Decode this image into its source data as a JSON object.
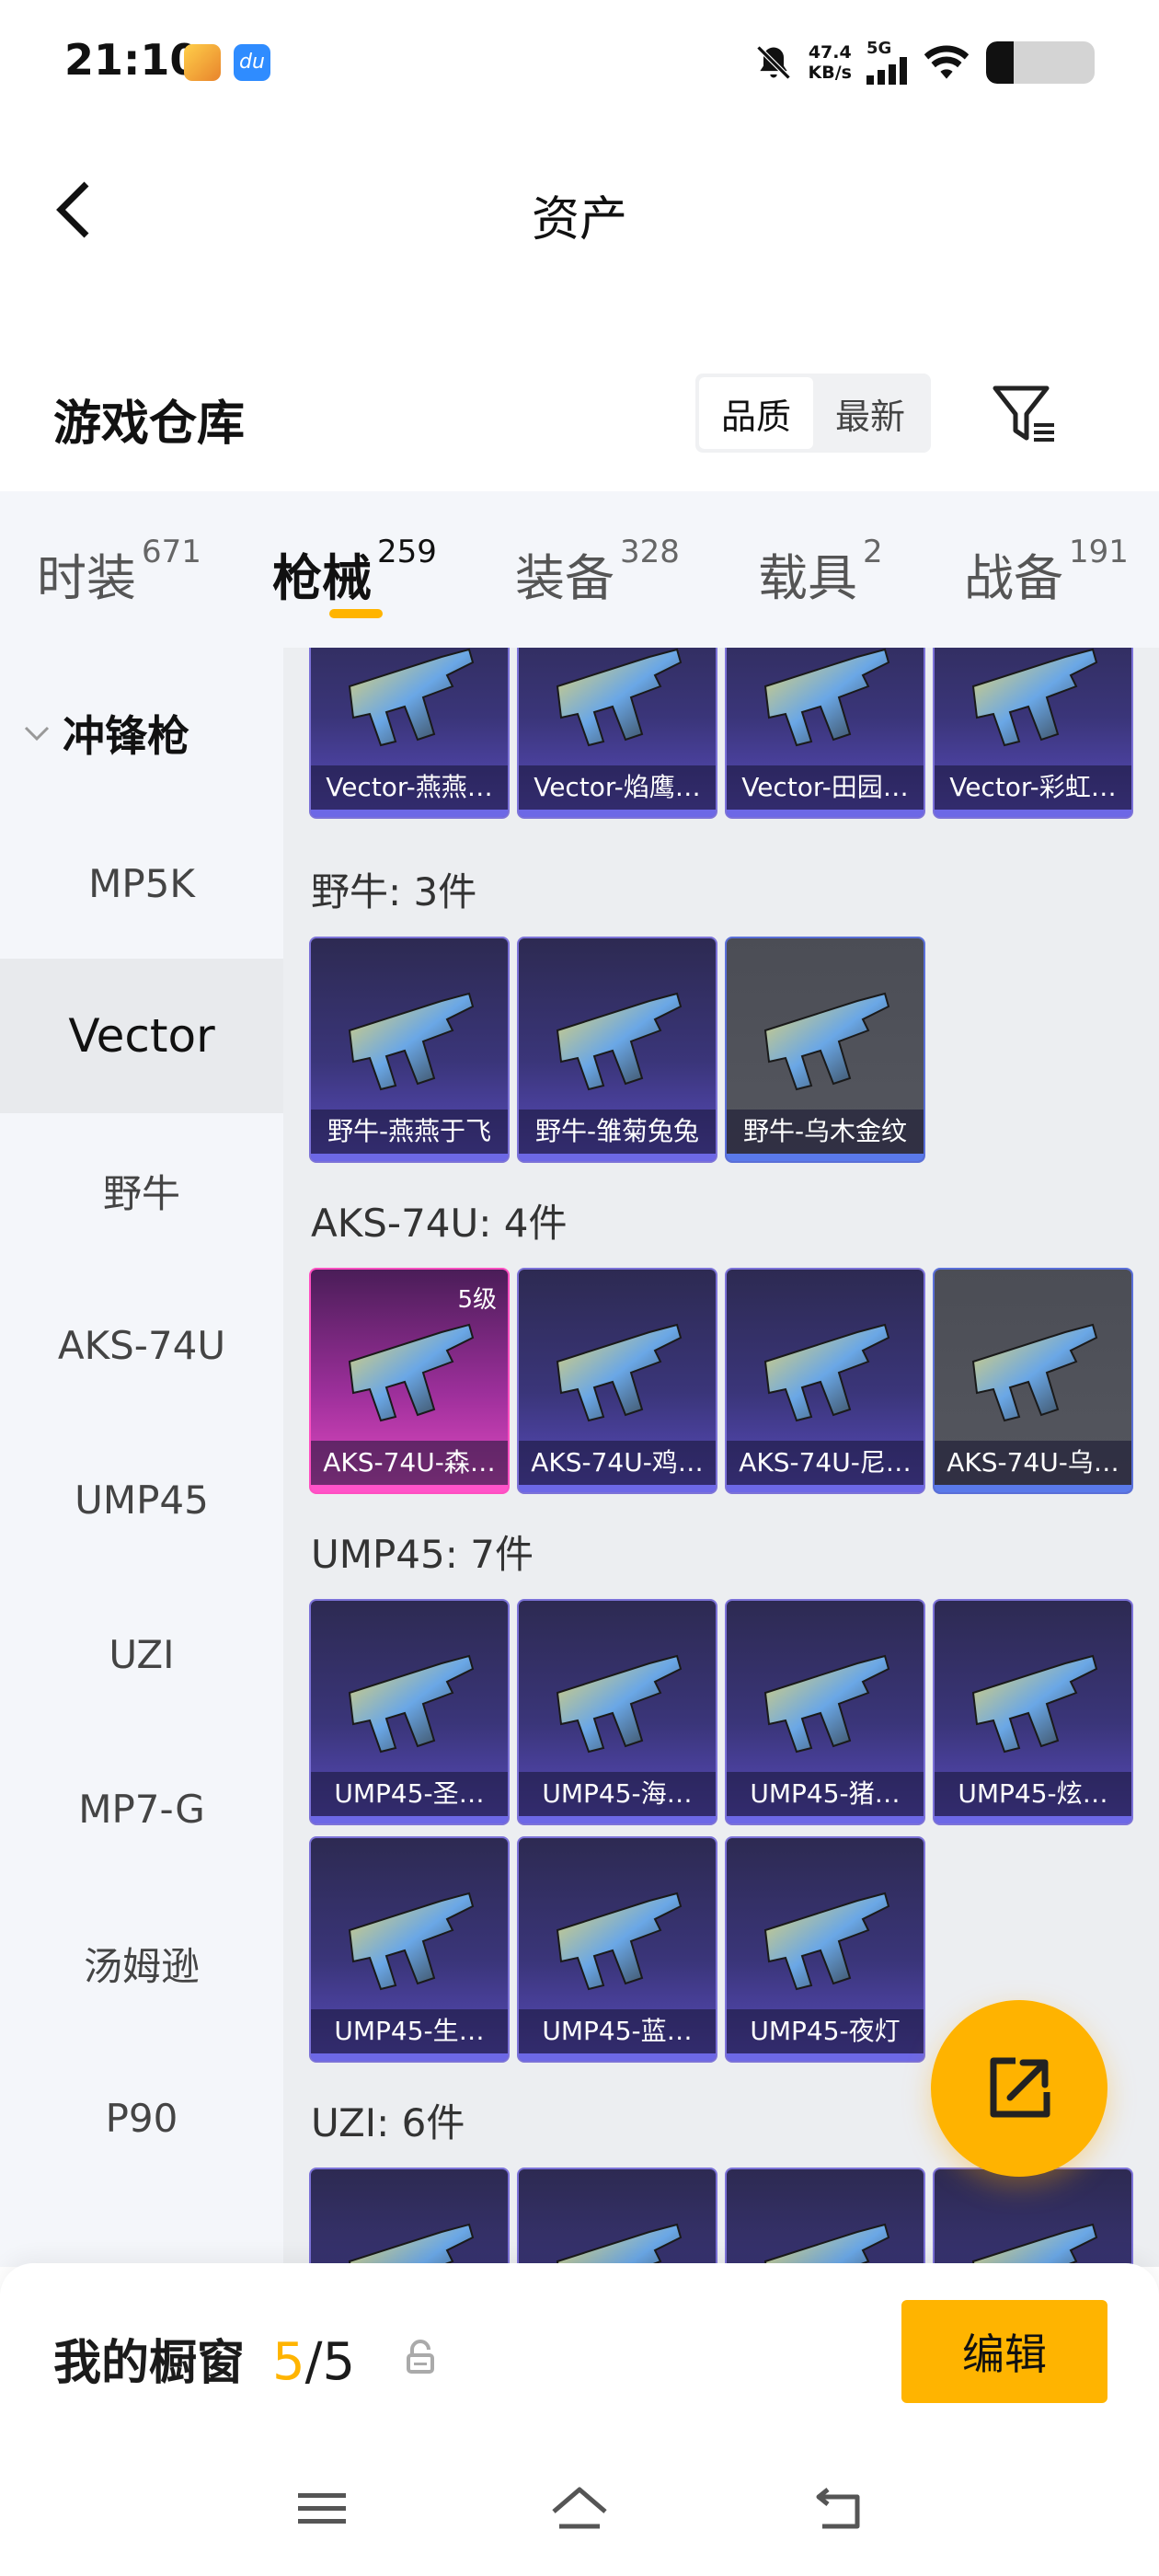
{
  "status_bar": {
    "time": "21:10",
    "net_speed": "47.4",
    "net_unit": "KB/s",
    "network": "5G",
    "battery_level": 0.25,
    "icons": [
      "game-app-icon",
      "du-app-icon",
      "mute-icon",
      "signal-icon",
      "wifi-icon",
      "battery-icon"
    ]
  },
  "header": {
    "title": "资产",
    "back_icon": "chevron-left-icon"
  },
  "warehouse": {
    "title": "游戏仓库",
    "sort_options": [
      "品质",
      "最新"
    ],
    "sort_selected": "品质",
    "filter_icon": "filter-icon"
  },
  "tabs": [
    {
      "label": "时装",
      "count": "671"
    },
    {
      "label": "枪械",
      "count": "259",
      "active": true
    },
    {
      "label": "装备",
      "count": "328"
    },
    {
      "label": "载具",
      "count": "2"
    },
    {
      "label": "战备",
      "count": "191"
    }
  ],
  "sidebar": {
    "group": "冲锋枪",
    "items": [
      "MP5K",
      "Vector",
      "野牛",
      "AKS-74U",
      "UMP45",
      "UZI",
      "MP7-G",
      "汤姆逊",
      "P90"
    ],
    "selected": "Vector"
  },
  "inventory": {
    "vector_cards": [
      "Vector-燕燕…",
      "Vector-焰鹰…",
      "Vector-田园…",
      "Vector-彩虹…"
    ],
    "groups": [
      {
        "title": "野牛: 3件",
        "cards": [
          {
            "name": "野牛-燕燕于飞",
            "quality": "purple"
          },
          {
            "name": "野牛-雏菊兔兔",
            "quality": "purple"
          },
          {
            "name": "野牛-乌木金纹",
            "quality": "gray"
          }
        ]
      },
      {
        "title": "AKS-74U: 4件",
        "cards": [
          {
            "name": "AKS-74U-森…",
            "quality": "pink",
            "level": "5级"
          },
          {
            "name": "AKS-74U-鸡…",
            "quality": "purple"
          },
          {
            "name": "AKS-74U-尼…",
            "quality": "purple"
          },
          {
            "name": "AKS-74U-乌…",
            "quality": "gray"
          }
        ]
      },
      {
        "title": "UMP45: 7件",
        "cards": [
          {
            "name": "UMP45-圣…",
            "quality": "purple"
          },
          {
            "name": "UMP45-海…",
            "quality": "purple"
          },
          {
            "name": "UMP45-猪…",
            "quality": "purple"
          },
          {
            "name": "UMP45-炫…",
            "quality": "purple"
          },
          {
            "name": "UMP45-生…",
            "quality": "purple"
          },
          {
            "name": "UMP45-蓝…",
            "quality": "purple"
          },
          {
            "name": "UMP45-夜灯",
            "quality": "purple"
          }
        ]
      },
      {
        "title": "UZI: 6件",
        "cards": []
      }
    ]
  },
  "fab": {
    "icon": "share-external-icon"
  },
  "showcase": {
    "label": "我的橱窗",
    "count": "5",
    "separator": "/",
    "total": "5",
    "lock_icon": "lock-icon",
    "edit_label": "编辑"
  },
  "nav_bar": {
    "icons": [
      "menu-icon",
      "home-icon",
      "back-icon"
    ]
  },
  "colors": {
    "accent": "#ffb400",
    "purple_border": "#7c72d8",
    "pink_border": "#ff4fc1"
  }
}
